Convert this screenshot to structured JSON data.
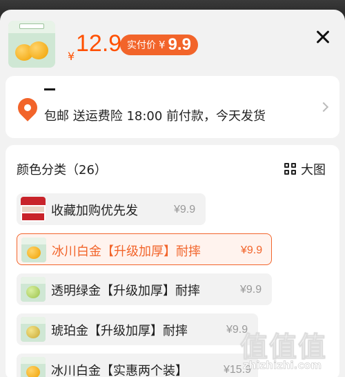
{
  "header": {
    "currency": "¥",
    "price": "12.9",
    "paid_label": "实付价",
    "paid_currency": "¥",
    "paid_price": "9.9",
    "close_icon": "close-icon"
  },
  "shipping": {
    "text": "包邮  送运费险  18:00 前付款，今天发货",
    "location_icon": "location-pin-icon",
    "chevron_icon": "chevron-right-icon"
  },
  "variants": {
    "title": "颜色分类（26）",
    "big_image_label": "大图",
    "options": [
      {
        "label": "收藏加购优先发",
        "price": "¥9.9",
        "selected": false
      },
      {
        "label": "冰川白金【升级加厚】耐摔",
        "price": "¥9.9",
        "selected": true
      },
      {
        "label": "透明绿金【升级加厚】耐摔",
        "price": "¥9.9",
        "selected": false
      },
      {
        "label": "琥珀金【升级加厚】耐摔",
        "price": "¥9.9",
        "selected": false
      },
      {
        "label": "冰川白金【实惠两个装】",
        "price": "¥15.9",
        "selected": false
      }
    ]
  },
  "watermark": {
    "text": "值值值",
    "url": "zhizhizhi.com"
  },
  "colors": {
    "accent": "#f2642a",
    "price": "#ff5000"
  }
}
